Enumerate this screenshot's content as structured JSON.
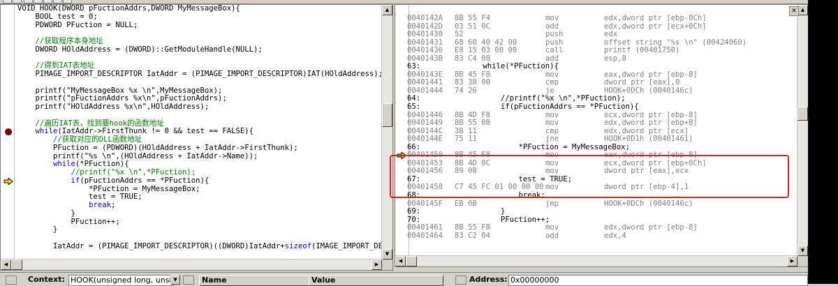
{
  "source": {
    "lines": [
      [
        {
          "t": "VOID HOOK(DWORD pFuctionAddrs,DWORD MyMessageBox){",
          "c": "txt"
        }
      ],
      [
        {
          "t": "    BOOL test = 0;",
          "c": "txt"
        }
      ],
      [
        {
          "t": "    PDWORD PFuction = NULL;",
          "c": "txt"
        }
      ],
      [
        {
          "t": "",
          "c": "txt"
        }
      ],
      [
        {
          "t": "    //获取程序本身地址",
          "c": "cm"
        }
      ],
      [
        {
          "t": "    DWORD HOldAddress = (DWORD)::GetModuleHandle(NULL);",
          "c": "txt"
        }
      ],
      [
        {
          "t": "",
          "c": "txt"
        }
      ],
      [
        {
          "t": "    //得到IAT表地址",
          "c": "cm"
        }
      ],
      [
        {
          "t": "    PIMAGE_IMPORT_DESCRIPTOR IatAddr = (PIMAGE_IMPORT_DESCRIPTOR)IAT(HOldAddress);",
          "c": "txt"
        }
      ],
      [
        {
          "t": "",
          "c": "txt"
        }
      ],
      [
        {
          "t": "    printf(\"MyMessageBox %x \\n\",MyMessageBox);",
          "c": "txt"
        }
      ],
      [
        {
          "t": "    printf(\"pFuctionAddrs %x\\n\",pFuctionAddrs);",
          "c": "txt"
        }
      ],
      [
        {
          "t": "    printf(\"HOldAddress %x\\n\",HOldAddress);",
          "c": "txt"
        }
      ],
      [
        {
          "t": "",
          "c": "txt"
        }
      ],
      [
        {
          "t": "    //遍历IAT表，找到要hook的函数地址",
          "c": "cm"
        }
      ],
      [
        {
          "t": "    ",
          "c": "txt"
        },
        {
          "t": "while",
          "c": "kw"
        },
        {
          "t": "(IatAddr->FirstThunk != 0 && test == FALSE){",
          "c": "txt"
        }
      ],
      [
        {
          "t": "        //获取对应的DLL函数地址",
          "c": "cm"
        }
      ],
      [
        {
          "t": "        PFuction = (PDWORD)(HOldAddress + IatAddr->FirstThunk);",
          "c": "txt"
        }
      ],
      [
        {
          "t": "        printf(\"%s \\n\",(HOldAddress + IatAddr->Name));",
          "c": "txt"
        }
      ],
      [
        {
          "t": "        ",
          "c": "txt"
        },
        {
          "t": "while",
          "c": "kw"
        },
        {
          "t": "(*PFuction){",
          "c": "txt"
        }
      ],
      [
        {
          "t": "            //printf(\"%x \\n\",*PFuction);",
          "c": "cm"
        }
      ],
      [
        {
          "t": "            ",
          "c": "txt"
        },
        {
          "t": "if",
          "c": "kw"
        },
        {
          "t": "(pFuctionAddrs == *PFuction){",
          "c": "txt"
        }
      ],
      [
        {
          "t": "                *PFuction = MyMessageBox;",
          "c": "txt"
        }
      ],
      [
        {
          "t": "                test = TRUE;",
          "c": "txt"
        }
      ],
      [
        {
          "t": "                ",
          "c": "txt"
        },
        {
          "t": "break",
          "c": "kw"
        },
        {
          "t": ";",
          "c": "txt"
        }
      ],
      [
        {
          "t": "            }",
          "c": "txt"
        }
      ],
      [
        {
          "t": "            PFuction++;",
          "c": "txt"
        }
      ],
      [
        {
          "t": "        }",
          "c": "txt"
        }
      ],
      [
        {
          "t": "",
          "c": "txt"
        }
      ],
      [
        {
          "t": "        IatAddr = (PIMAGE_IMPORT_DESCRIPTOR)((DWORD)IatAddr+",
          "c": "txt"
        },
        {
          "t": "sizeof",
          "c": "kw"
        },
        {
          "t": "(IMAGE_IMPORT_DESCR",
          "c": "txt"
        }
      ]
    ],
    "breakpoint_line": 15,
    "current_line": 21
  },
  "disasm": {
    "rows": [
      {
        "addr": "0040142A",
        "bytes": "8B 55 F4",
        "mn": "mov",
        "op": "edx,dword ptr [ebp-0Ch]"
      },
      {
        "addr": "0040142D",
        "bytes": "03 51 0C",
        "mn": "add",
        "op": "edx,dword ptr [ecx+0Ch]"
      },
      {
        "addr": "00401430",
        "bytes": "52",
        "mn": "push",
        "op": "edx"
      },
      {
        "addr": "00401431",
        "bytes": "68 60 40 42 00",
        "mn": "push",
        "op": "offset string \"%s \\n\" (00424060)"
      },
      {
        "addr": "00401436",
        "bytes": "E8 15 03 00 00",
        "mn": "call",
        "op": "printf (00401750)"
      },
      {
        "addr": "0040143B",
        "bytes": "83 C4 08",
        "mn": "add",
        "op": "esp,8"
      },
      {
        "src": "63:              while(*PFuction){"
      },
      {
        "addr": "0040143E",
        "bytes": "8B 45 F8",
        "mn": "mov",
        "op": "eax,dword ptr [ebp-8]"
      },
      {
        "addr": "00401441",
        "bytes": "83 38 00",
        "mn": "cmp",
        "op": "dword ptr [eax],0"
      },
      {
        "addr": "00401444",
        "bytes": "74 26",
        "mn": "je",
        "op": "HOOK+0DCh (0040146c)"
      },
      {
        "src": "64:                  //printf(\"%x \\n\",*PFuction);"
      },
      {
        "src": "65:                  if(pFuctionAddrs == *PFuction){"
      },
      {
        "addr": "00401446",
        "bytes": "8B 4D F8",
        "mn": "mov",
        "op": "ecx,dword ptr [ebp-8]"
      },
      {
        "addr": "00401449",
        "bytes": "8B 55 08",
        "mn": "mov",
        "op": "edx,dword ptr [ebp+8]"
      },
      {
        "addr": "0040144C",
        "bytes": "3B 11",
        "mn": "cmp",
        "op": "edx,dword ptr [ecx]"
      },
      {
        "addr": "0040144E",
        "bytes": "75 11",
        "mn": "jne",
        "op": "HOOK+0D1h (00401461)"
      },
      {
        "src": "66:                      *PFuction = MyMessageBox;"
      },
      {
        "addr": "00401450",
        "bytes": "8B 45 F8",
        "mn": "mov",
        "op": "eax,dword ptr [ebp-8]"
      },
      {
        "addr": "00401453",
        "bytes": "8B 4D 0C",
        "mn": "mov",
        "op": "ecx,dword ptr [ebp+0Ch]"
      },
      {
        "addr": "00401456",
        "bytes": "89 08",
        "mn": "mov",
        "op": "dword ptr [eax],ecx"
      },
      {
        "src": "67:                      test = TRUE;"
      },
      {
        "addr": "00401458",
        "bytes": "C7 45 FC 01 00 00 00",
        "mn": "mov",
        "op": "dword ptr [ebp-4],1"
      },
      {
        "src": "68:                      break;"
      },
      {
        "addr": "0040145F",
        "bytes": "EB 0B",
        "mn": "jmp",
        "op": "HOOK+0DCh (0040146c)"
      },
      {
        "src": "69:                  }"
      },
      {
        "src": "70:                  PFuction++;"
      },
      {
        "addr": "00401461",
        "bytes": "8B 55 F8",
        "mn": "mov",
        "op": "edx,dword ptr [ebp-8]"
      },
      {
        "addr": "00401464",
        "bytes": "83 C2 04",
        "mn": "add",
        "op": "edx,4"
      }
    ],
    "current_row": 17
  },
  "bottom": {
    "context_label": "Context:",
    "context_value": "HOOK(unsigned long, unsigned",
    "name_header": "Name",
    "value_header": "Value",
    "address_label": "Address:",
    "address_value": "0x00000000"
  },
  "colors": {
    "keyword": "#0000ff",
    "comment": "#008000",
    "breakpoint": "#8b0000",
    "current_arrow": "#ffd700",
    "highlight_box": "#e31c1c"
  }
}
